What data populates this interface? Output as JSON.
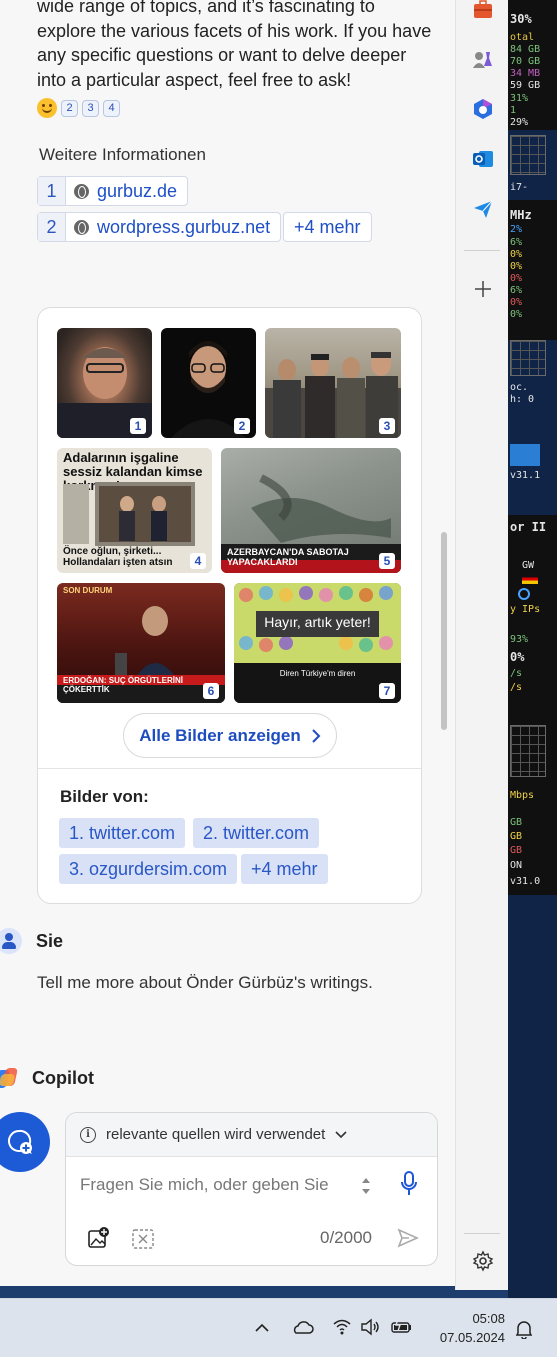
{
  "copilot": {
    "intro_text": "wide range of topics, and it’s fascinating to explore the various facets of his work. If you have any specific questions or want to delve deeper into a particular aspect, feel free to ask!",
    "citations": [
      "2",
      "3",
      "4"
    ],
    "more_info_title": "Weitere Informationen",
    "sources": [
      {
        "num": "1",
        "label": "gurbuz.de"
      },
      {
        "num": "2",
        "label": "wordpress.gurbuz.net"
      }
    ],
    "more_sources": "+4 mehr",
    "images": {
      "badges": [
        "1",
        "2",
        "3",
        "4",
        "5",
        "6",
        "7"
      ],
      "captions": {
        "img4_headline": "Adalarının işgaline sessiz kalandan kimse korkmaz!",
        "img4_sub": "Önce oğlun, şirketi... Hollandaları işten atsın",
        "img5_headline": "AZERBAYCAN'DA SABOTAJ YAPACAKLARDI",
        "img6_top": "SON DURUM",
        "img6_headline": "ERDOĞAN: SUÇ ÖRGÜTLERİNİ ÇÖKERTTİK",
        "img7_title": "Hayır, artık yeter!",
        "img7_sub": "Diren Türkiye'm diren"
      },
      "show_all": "Alle Bilder anzeigen",
      "from_label": "Bilder von:",
      "from_chips": [
        "1. twitter.com",
        "2. twitter.com",
        "3. ozgurdersim.com",
        "+4 mehr"
      ]
    },
    "user_name": "Sie",
    "user_message": "Tell me more about Önder Gürbüz's writings.",
    "assistant_name": "Copilot",
    "composer": {
      "sources_label": "relevante quellen wird verwendet",
      "placeholder": "Fragen Sie mich, oder geben Sie",
      "counter": "0/2000"
    }
  },
  "sidebar_icons": [
    "toolbox-icon",
    "games-icon",
    "m365-icon",
    "outlook-icon",
    "send-icon",
    "add-icon",
    "settings-icon"
  ],
  "widget": {
    "lines_top": [
      "30%",
      "otal",
      "84 GB",
      "70 GB",
      "34 MB",
      "59 GB",
      "31%",
      "1",
      "29%"
    ],
    "cpu_label": "i7-",
    "mhz": "MHz",
    "percents": [
      "2%",
      "6%",
      "0%",
      "0%",
      "0%",
      "6%",
      "0%",
      "0%"
    ],
    "small_lines": [
      "oc.",
      "h: 0"
    ],
    "version1": "v31.1",
    "section2": "or II",
    "gw": "GW",
    "ips": "y IPs",
    "p93": "93%",
    "p0": "0%",
    "s1": "/s",
    "s2": "/s",
    "mbps": "Mbps",
    "gb1": "GB",
    "gb2": "GB",
    "gb3": "GB",
    "on": "ON",
    "version2": "v31.0"
  },
  "taskbar": {
    "time": "05:08",
    "date": "07.05.2024"
  },
  "colors": {
    "accent": "#1f4fc6",
    "new_chat": "#1d5ad6",
    "desktop": "#1c3d6e"
  }
}
